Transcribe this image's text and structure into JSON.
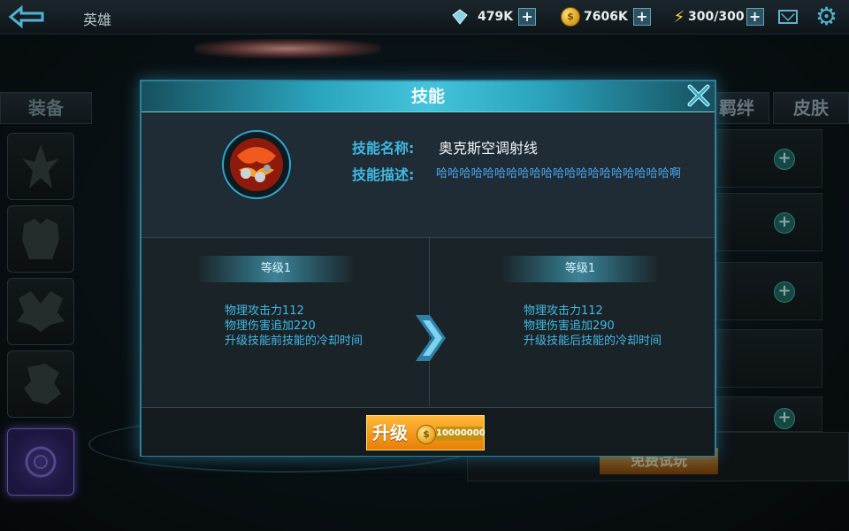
{
  "topbar": {
    "title": "英雄",
    "gems": "479K",
    "gold": "7606K",
    "energy": "300/300",
    "coin_symbol": "$"
  },
  "left_panel": {
    "equip_tab": "装备",
    "slots": [
      "weapon",
      "armor",
      "wings",
      "pet",
      "selected"
    ]
  },
  "right_panel": {
    "tabs": [
      "羁绊",
      "皮肤"
    ],
    "trial_button": "免费试玩"
  },
  "dialog": {
    "title": "技能",
    "name_label": "技能名称:",
    "name_value": "奥克斯空调射线",
    "desc_label": "技能描述:",
    "desc_value": "哈哈哈哈哈哈哈哈哈哈哈哈哈哈哈哈哈哈哈哈啊",
    "current": {
      "level": "等级1",
      "stat1": "物理攻击力112",
      "stat2": "物理伤害追加220",
      "stat3": "升级技能前技能的冷却时间"
    },
    "next": {
      "level": "等级1",
      "stat1": "物理攻击力112",
      "stat2": "物理伤害追加290",
      "stat3": "升级技能后技能的冷却时间"
    },
    "upgrade_label": "升级",
    "upgrade_cost": "10000000"
  },
  "colors": {
    "accent": "#41b8e0",
    "header": "#2aa3bc",
    "upgrade": "#f39a1c"
  }
}
